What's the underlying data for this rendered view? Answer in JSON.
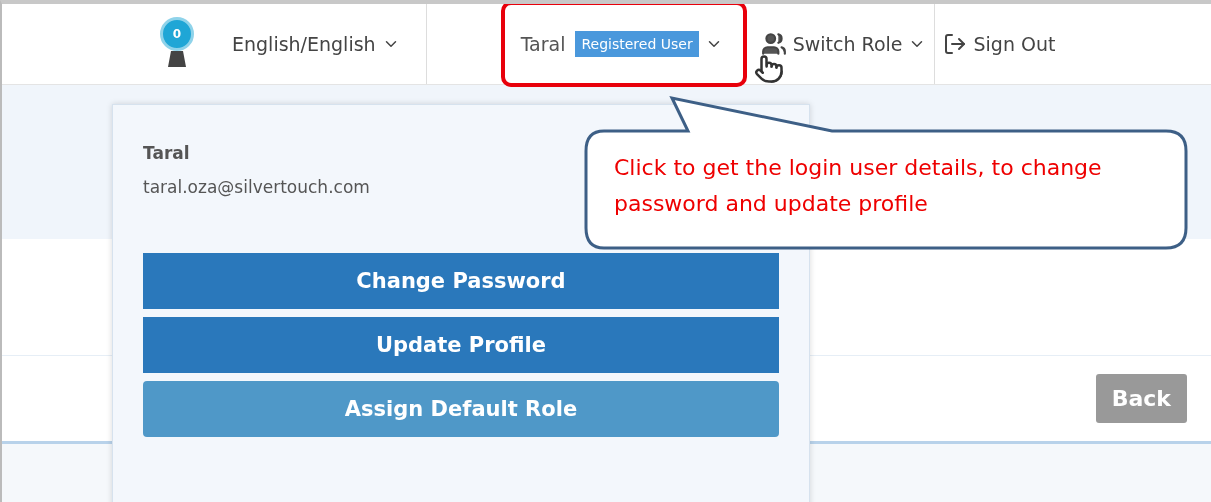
{
  "header": {
    "badge_count": "0",
    "language": "English/English",
    "user": {
      "name": "Taral",
      "role": "Registered User",
      "expanded": true
    },
    "switch_role": "Switch Role",
    "sign_out": "Sign Out"
  },
  "user_menu": {
    "name": "Taral",
    "email": "taral.oza@silvertouch.com",
    "buttons": [
      {
        "label": "Change Password",
        "kind": "primary"
      },
      {
        "label": "Update Profile",
        "kind": "primary"
      },
      {
        "label": "Assign Default Role",
        "kind": "secondary"
      }
    ]
  },
  "back_button": "Back",
  "annotation": {
    "text": "Click to get the login user details, to change password and update profile"
  }
}
